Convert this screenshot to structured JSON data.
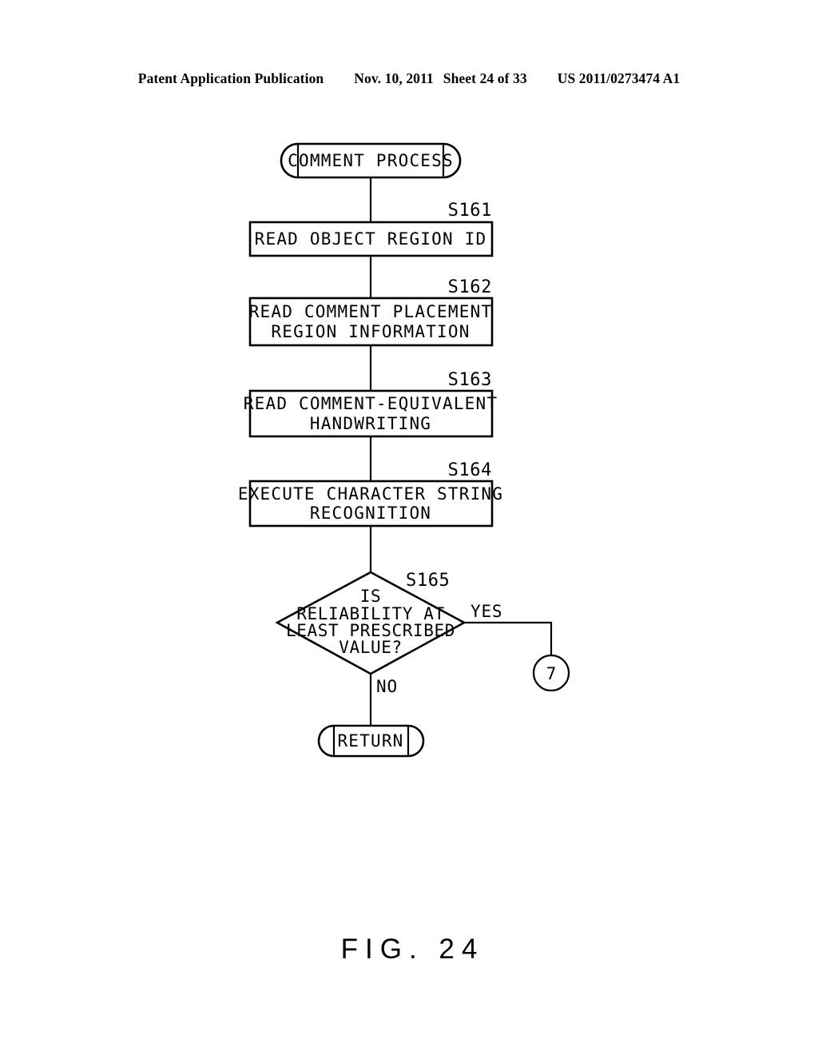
{
  "header": {
    "publication": "Patent Application Publication",
    "date": "Nov. 10, 2011",
    "sheet": "Sheet 24 of 33",
    "patent_number": "US 2011/0273474 A1"
  },
  "figure": {
    "caption": "FIG. 24"
  },
  "flowchart": {
    "start_terminal": "COMMENT PROCESS",
    "end_terminal": "RETURN",
    "steps": [
      {
        "id": "S161",
        "lines": [
          "READ OBJECT REGION ID"
        ]
      },
      {
        "id": "S162",
        "lines": [
          "READ COMMENT PLACEMENT",
          "REGION INFORMATION"
        ]
      },
      {
        "id": "S163",
        "lines": [
          "READ COMMENT-EQUIVALENT",
          "HANDWRITING"
        ]
      },
      {
        "id": "S164",
        "lines": [
          "EXECUTE CHARACTER STRING",
          "RECOGNITION"
        ]
      }
    ],
    "decision": {
      "id": "S165",
      "lines": [
        "IS",
        "RELIABILITY AT",
        "LEAST PRESCRIBED",
        "VALUE?"
      ],
      "yes_label": "YES",
      "no_label": "NO"
    },
    "connector": {
      "label": "7"
    }
  },
  "colors": {
    "ink": "#000000",
    "paper": "#ffffff"
  }
}
